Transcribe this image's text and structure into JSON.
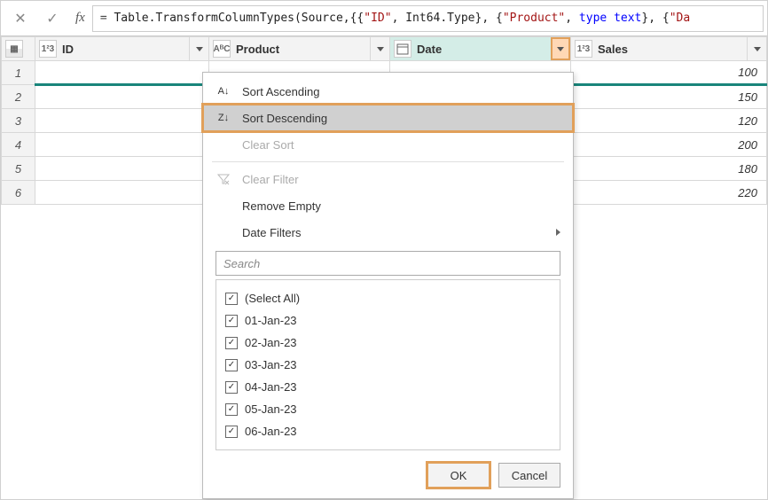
{
  "formula_bar": {
    "fx_label": "fx",
    "raw": "= Table.TransformColumnTypes(Source,{{\"ID\", Int64.Type}, {\"Product\", type text}, {\"Da",
    "tokens": {
      "eq": "= ",
      "call1": "Table.TransformColumnTypes(Source,{{",
      "s_id": "\"ID\"",
      "sep1": ", ",
      "t_int": "Int64.Type",
      "sep2": "}, {",
      "s_prod": "\"Product\"",
      "sep3": ", ",
      "kw_type": "type",
      "sp": " ",
      "kw_text": "text",
      "sep4": "}, {",
      "s_date": "\"Da"
    }
  },
  "columns": {
    "id": {
      "name": "ID",
      "type_label": "1²3"
    },
    "prod": {
      "name": "Product",
      "type_label": "AᴮC"
    },
    "date": {
      "name": "Date",
      "type_label": ""
    },
    "sales": {
      "name": "Sales",
      "type_label": "1²3"
    }
  },
  "rows": [
    {
      "n": "1",
      "sales": "100"
    },
    {
      "n": "2",
      "sales": "150"
    },
    {
      "n": "3",
      "sales": "120"
    },
    {
      "n": "4",
      "sales": "200"
    },
    {
      "n": "5",
      "sales": "180"
    },
    {
      "n": "6",
      "sales": "220"
    }
  ],
  "menu": {
    "sort_asc": "Sort Ascending",
    "sort_desc": "Sort Descending",
    "clear_sort": "Clear Sort",
    "clear_filter": "Clear Filter",
    "remove_empty": "Remove Empty",
    "date_filters": "Date Filters",
    "search_placeholder": "Search",
    "values": [
      "(Select All)",
      "01-Jan-23",
      "02-Jan-23",
      "03-Jan-23",
      "04-Jan-23",
      "05-Jan-23",
      "06-Jan-23"
    ],
    "ok": "OK",
    "cancel": "Cancel"
  }
}
